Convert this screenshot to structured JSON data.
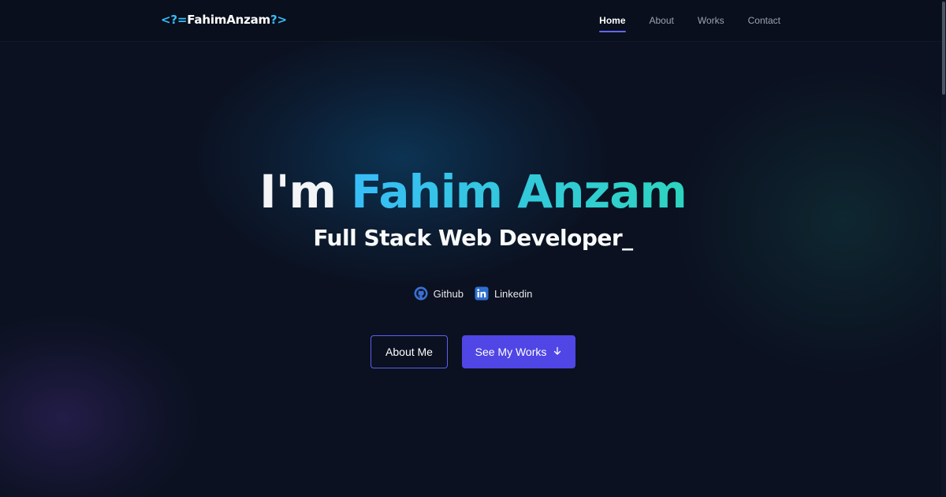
{
  "header": {
    "logo": {
      "open": "<?=",
      "name": "FahimAnzam",
      "close": "?>"
    },
    "nav": [
      {
        "label": "Home",
        "active": true
      },
      {
        "label": "About",
        "active": false
      },
      {
        "label": "Works",
        "active": false
      },
      {
        "label": "Contact",
        "active": false
      }
    ]
  },
  "hero": {
    "title_prefix": "I'm ",
    "title_name": "Fahim Anzam",
    "subtitle": "Full Stack Web Developer",
    "cursor": "_",
    "social": [
      {
        "label": "Github",
        "icon": "github-icon"
      },
      {
        "label": "Linkedin",
        "icon": "linkedin-icon"
      }
    ],
    "buttons": {
      "about": "About Me",
      "works": "See My Works",
      "works_icon": "arrow-down-icon"
    }
  },
  "colors": {
    "background": "#0b1120",
    "accent": "#5046e5",
    "gradient_start": "#38bdf8",
    "gradient_end": "#2dd4bf",
    "logo_brackets": "#38bdf8"
  }
}
